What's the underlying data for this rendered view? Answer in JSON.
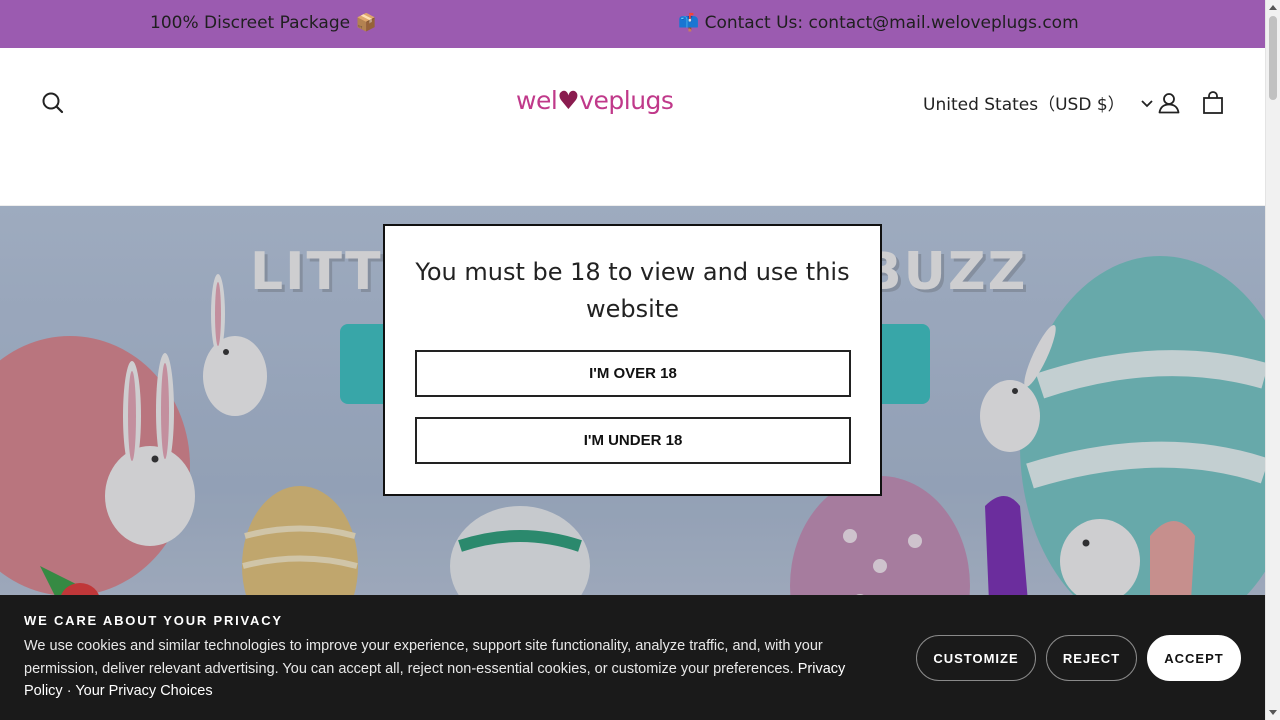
{
  "announcement": {
    "left_text": "100% Discreet Package 📦",
    "right_text": "📫 Contact Us: contact@mail.weloveplugs.com",
    "bg_color": "#9b5bb0"
  },
  "header": {
    "logo": {
      "part1": "wel",
      "heart": "♥",
      "part2": "ve",
      "part3": "plugs"
    },
    "currency_label": "United States（USD $）",
    "icons": [
      "search-icon",
      "account-icon",
      "cart-icon",
      "chevron-down-icon"
    ]
  },
  "hero": {
    "title_left": "LITT",
    "title_right": "BUZZ"
  },
  "age_gate": {
    "heading": "You must be 18 to view and use this website",
    "over_label": "I'M OVER 18",
    "under_label": "I'M UNDER 18"
  },
  "cookie_banner": {
    "title": "WE CARE ABOUT YOUR PRIVACY",
    "body": "We use cookies and similar technologies to improve your experience, support site functionality, analyze traffic, and, with your permission, deliver relevant advertising. You can accept all, reject non-essential cookies, or customize your preferences.",
    "privacy_link": "Privacy Policy",
    "separator": " · ",
    "choices_link": "Your Privacy Choices",
    "customize_label": "CUSTOMIZE",
    "reject_label": "REJECT",
    "accept_label": "ACCEPT"
  }
}
